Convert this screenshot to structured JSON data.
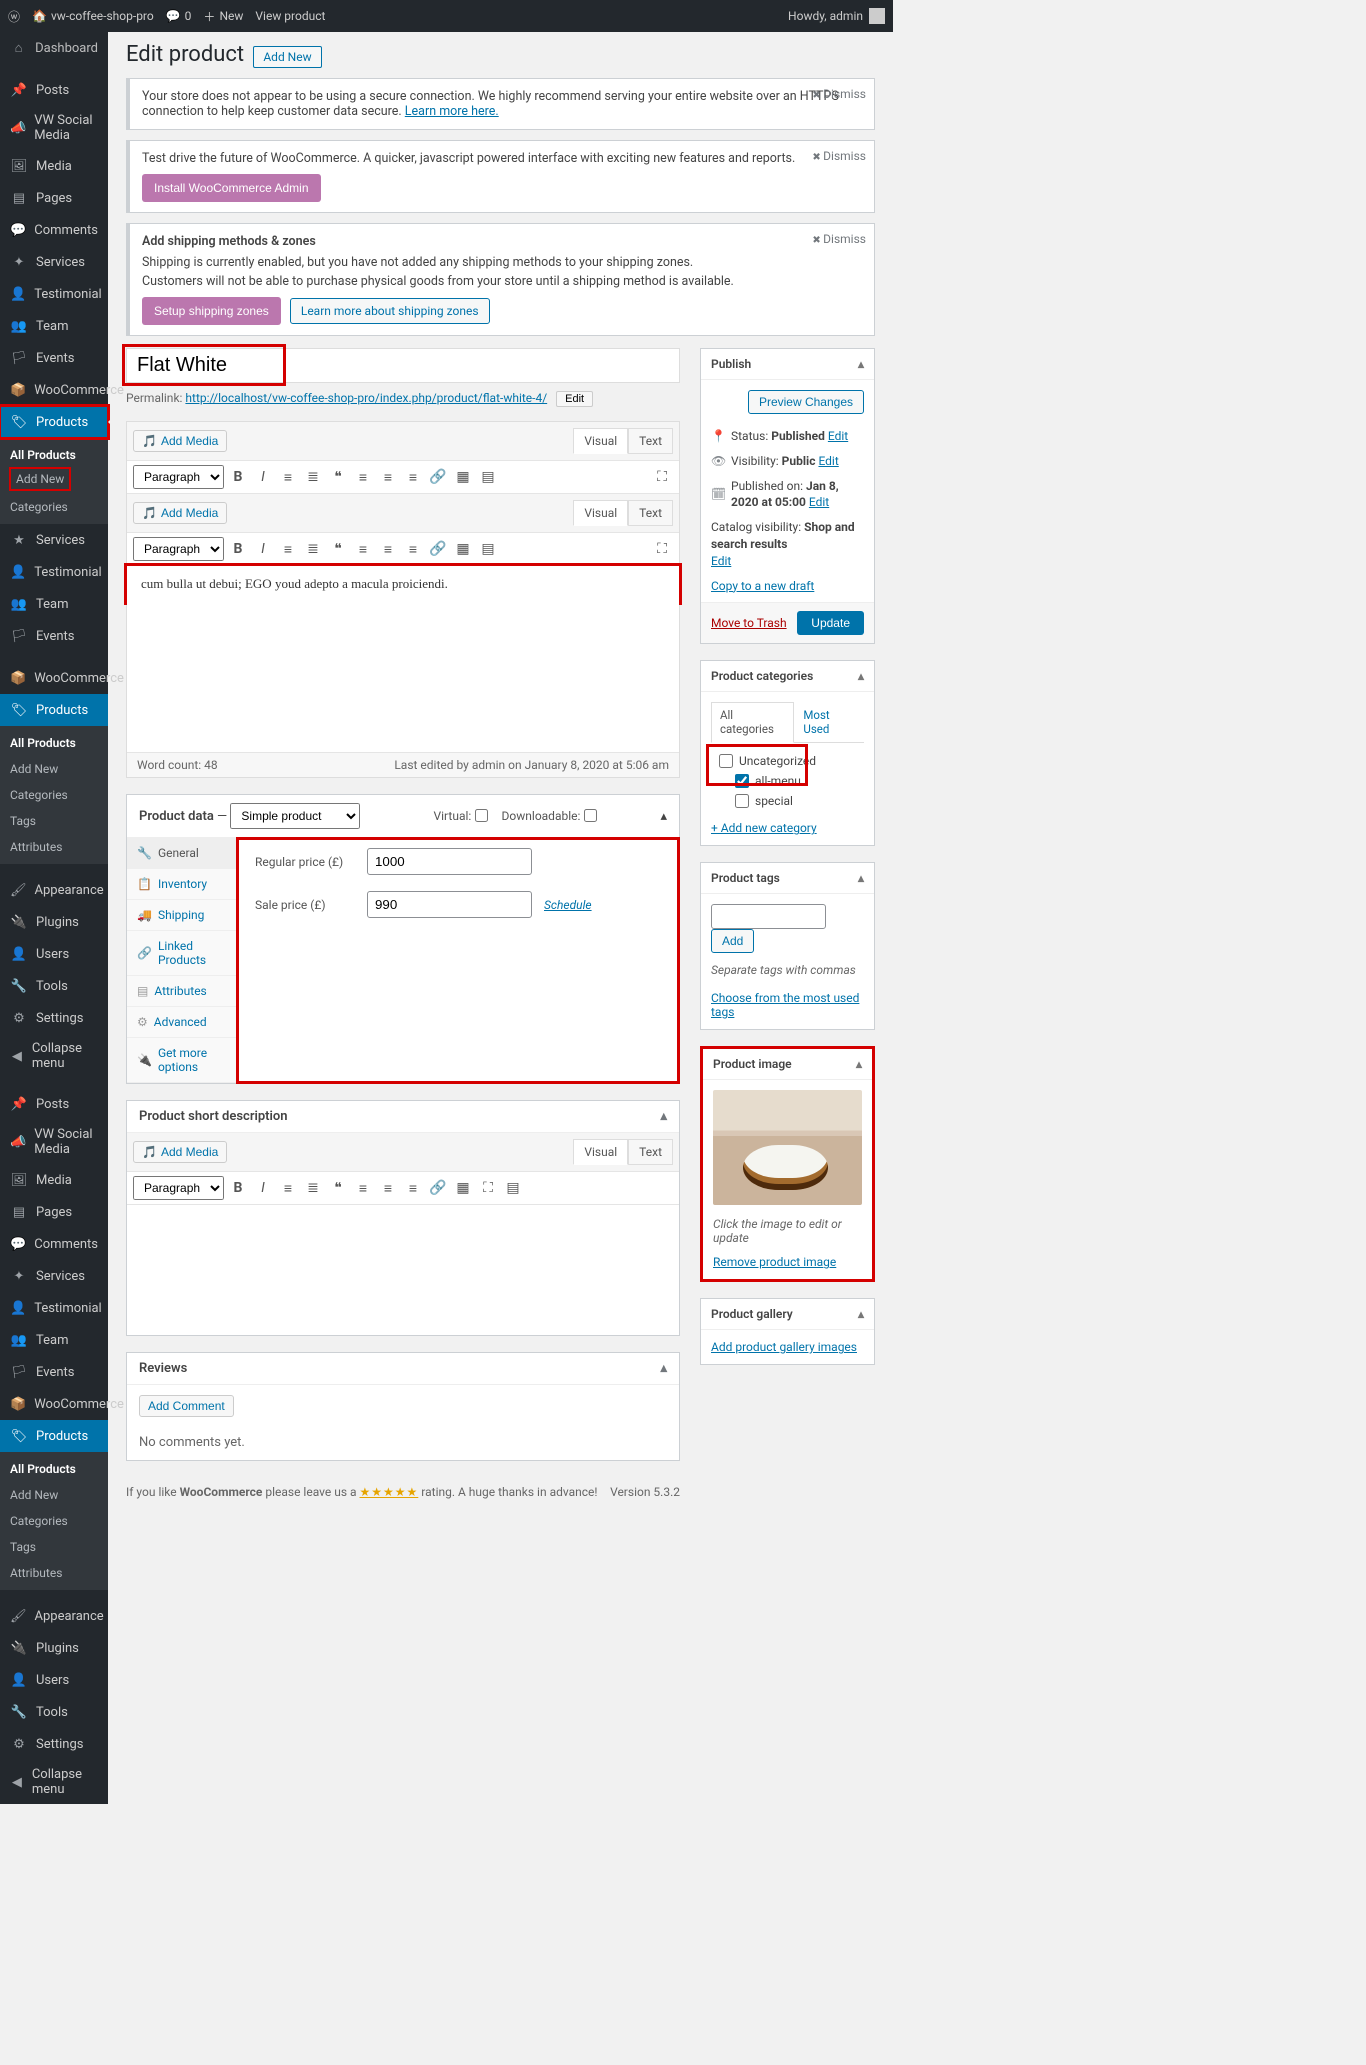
{
  "topbar": {
    "site": "vw-coffee-shop-pro",
    "comments": "0",
    "new": "New",
    "view": "View product",
    "howdy": "Howdy, admin"
  },
  "sidebar": {
    "dashboard": "Dashboard",
    "posts": "Posts",
    "social": "VW Social Media",
    "media": "Media",
    "pages": "Pages",
    "comments": "Comments",
    "services": "Services",
    "testimonial": "Testimonial",
    "team": "Team",
    "events": "Events",
    "woo": "WooCommerce",
    "products": "Products",
    "all_products": "All Products",
    "add_new": "Add New",
    "categories": "Categories",
    "tags": "Tags",
    "attributes": "Attributes",
    "tc_services": "Services",
    "appearance": "Appearance",
    "plugins": "Plugins",
    "users": "Users",
    "tools": "Tools",
    "settings": "Settings",
    "collapse": "Collapse menu"
  },
  "page": {
    "heading": "Edit product",
    "add_new_btn": "Add New"
  },
  "notices": {
    "secure_text": "Your store does not appear to be using a secure connection. We highly recommend serving your entire website over an HTTPS connection to help keep customer data secure.",
    "secure_link": "Learn more here.",
    "dismiss": "Dismiss",
    "future_text": "Test drive the future of WooCommerce. A quicker, javascript powered interface with exciting new features and reports.",
    "install_btn": "Install WooCommerce Admin",
    "ship_title": "Add shipping methods & zones",
    "ship_l1": "Shipping is currently enabled, but you have not added any shipping methods to your shipping zones.",
    "ship_l2": "Customers will not be able to purchase physical goods from your store until a shipping method is available.",
    "ship_btn1": "Setup shipping zones",
    "ship_btn2": "Learn more about shipping zones"
  },
  "title": "Flat White",
  "permalink": {
    "label": "Permalink:",
    "url": "http://localhost/vw-coffee-shop-pro/index.php/product/flat-white-4/",
    "edit": "Edit"
  },
  "editor": {
    "add_media": "Add Media",
    "visual": "Visual",
    "text": "Text",
    "para": "Paragraph",
    "content": "cum bulla ut debui; EGO youd adepto a macula proiciendi.",
    "wordcount_label": "Word count: 48",
    "lastedit": "Last edited by admin on January 8, 2020 at 5:06 am"
  },
  "product_data": {
    "heading": "Product data",
    "simple": "Simple product",
    "virtual": "Virtual:",
    "download": "Downloadable:",
    "tabs": {
      "general": "General",
      "inventory": "Inventory",
      "shipping": "Shipping",
      "linked": "Linked Products",
      "attributes": "Attributes",
      "advanced": "Advanced",
      "more": "Get more options"
    },
    "regular_label": "Regular price (£)",
    "regular_val": "1000",
    "sale_label": "Sale price (£)",
    "sale_val": "990",
    "schedule": "Schedule"
  },
  "shortdesc": {
    "title": "Product short description",
    "add_media": "Add Media",
    "para": "Paragraph"
  },
  "reviews": {
    "title": "Reviews",
    "addcomment": "Add Comment",
    "empty": "No comments yet."
  },
  "publish": {
    "title": "Publish",
    "preview": "Preview Changes",
    "status_lbl": "Status:",
    "status_val": "Published",
    "edit": "Edit",
    "vis_lbl": "Visibility:",
    "vis_val": "Public",
    "pub_lbl": "Published on:",
    "pub_val": "Jan 8, 2020 at 05:00",
    "catvis_lbl": "Catalog visibility:",
    "catvis_val": "Shop and search results",
    "copy": "Copy to a new draft",
    "trash": "Move to Trash",
    "update": "Update"
  },
  "categories": {
    "title": "Product categories",
    "tab_all": "All categories",
    "tab_most": "Most Used",
    "uncat": "Uncategorized",
    "allmenu": "all-menu",
    "special": "special",
    "addnew": "+ Add new category"
  },
  "tags": {
    "title": "Product tags",
    "add": "Add",
    "sep": "Separate tags with commas",
    "choose": "Choose from the most used tags"
  },
  "pimage": {
    "title": "Product image",
    "click": "Click the image to edit or update",
    "remove": "Remove product image"
  },
  "gallery": {
    "title": "Product gallery",
    "add": "Add product gallery images"
  },
  "footer": {
    "text1": "If you like ",
    "woo": "WooCommerce",
    "text2": " please leave us a ",
    "stars": "★★★★★",
    "text3": " rating. A huge thanks in advance!",
    "version": "Version 5.3.2"
  }
}
